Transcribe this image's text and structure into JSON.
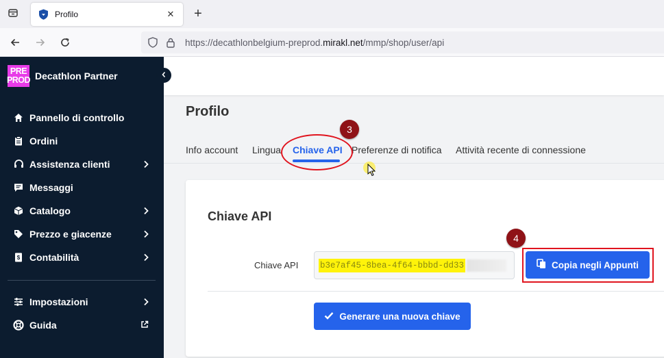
{
  "browser": {
    "tab_title": "Profilo",
    "url_prefix": "https://decathlonbelgium-preprod.",
    "url_domain": "mirakl.net",
    "url_path": "/mmp/shop/user/api"
  },
  "sidebar": {
    "logo_line1": "PRE",
    "logo_line2": "PROD",
    "brand_name": "Decathlon Partner",
    "items": [
      {
        "label": "Pannello di controllo",
        "icon": "home-icon",
        "chevron": false
      },
      {
        "label": "Ordini",
        "icon": "clipboard-icon",
        "chevron": false
      },
      {
        "label": "Assistenza clienti",
        "icon": "headset-icon",
        "chevron": true
      },
      {
        "label": "Messaggi",
        "icon": "message-icon",
        "chevron": false
      },
      {
        "label": "Catalogo",
        "icon": "box-icon",
        "chevron": true
      },
      {
        "label": "Prezzo e giacenze",
        "icon": "tag-icon",
        "chevron": true
      },
      {
        "label": "Contabilità",
        "icon": "invoice-icon",
        "chevron": true
      }
    ],
    "bottom_items": [
      {
        "label": "Impostazioni",
        "icon": "sliders-icon",
        "chevron": true
      },
      {
        "label": "Guida",
        "icon": "lifebuoy-icon",
        "external": true
      }
    ]
  },
  "page": {
    "title": "Profilo",
    "tabs": [
      "Info account",
      "Lingua",
      "Chiave API",
      "Preferenze di notifica",
      "Attività recente di connessione"
    ],
    "active_tab": "Chiave API"
  },
  "card": {
    "title": "Chiave API",
    "field_label": "Chiave API",
    "api_key_visible": "b3e7af45-8bea-4f64-bbbd-dd33",
    "copy_button": "Copia negli Appunti",
    "generate_button": "Generare una nuova chiave"
  },
  "annotations": {
    "step3": "3",
    "step4": "4"
  },
  "colors": {
    "sidebar_bg": "#0c1c2f",
    "accent": "#2563eb",
    "annotation_red": "#e0141e",
    "badge_red": "#8f1217",
    "highlight_yellow": "#fff30a"
  }
}
